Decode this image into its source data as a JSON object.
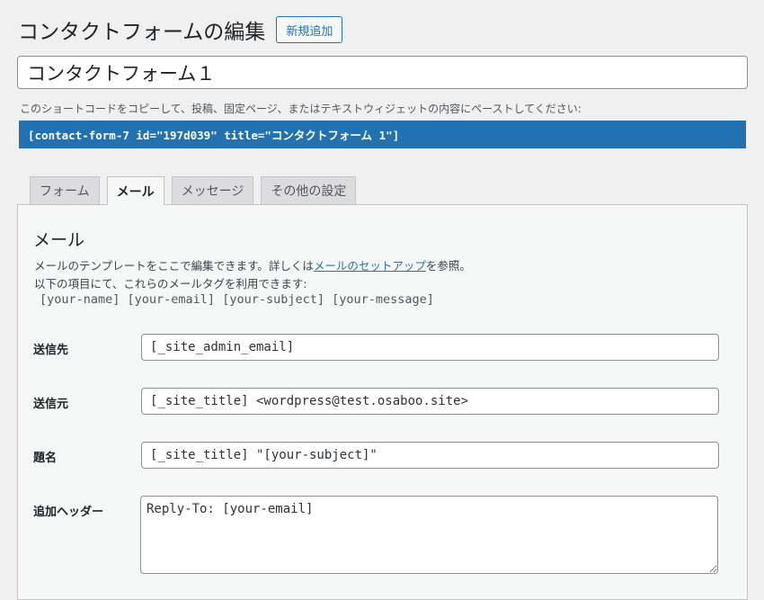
{
  "header": {
    "title": "コンタクトフォームの編集",
    "add_new_label": "新規追加"
  },
  "form_title": {
    "value": "コンタクトフォーム１"
  },
  "shortcode": {
    "description": "このショートコードをコピーして、投稿、固定ページ、またはテキストウィジェットの内容にペーストしてください:",
    "code": "[contact-form-7 id=\"197d039\" title=\"コンタクトフォーム 1\"]"
  },
  "tabs": [
    {
      "label": "フォーム",
      "active": false
    },
    {
      "label": "メール",
      "active": true
    },
    {
      "label": "メッセージ",
      "active": false
    },
    {
      "label": "その他の設定",
      "active": false
    }
  ],
  "mail_panel": {
    "heading": "メール",
    "desc_before_link": "メールのテンプレートをここで編集できます。詳しくは",
    "desc_link": "メールのセットアップ",
    "desc_after_link": "を参照。",
    "desc_line2": "以下の項目にて、これらのメールタグを利用できます:",
    "tags": "[your-name] [your-email] [your-subject] [your-message]",
    "fields": {
      "to": {
        "label": "送信先",
        "value": "[_site_admin_email]"
      },
      "from": {
        "label": "送信元",
        "value": "[_site_title] <wordpress@test.osaboo.site>"
      },
      "subject": {
        "label": "題名",
        "value": "[_site_title] \"[your-subject]\""
      },
      "headers": {
        "label": "追加ヘッダー",
        "value": "Reply-To: [your-email]"
      }
    }
  },
  "colors": {
    "accent": "#2271b1",
    "background": "#f0f0f1",
    "panel": "#f6f7f7"
  }
}
